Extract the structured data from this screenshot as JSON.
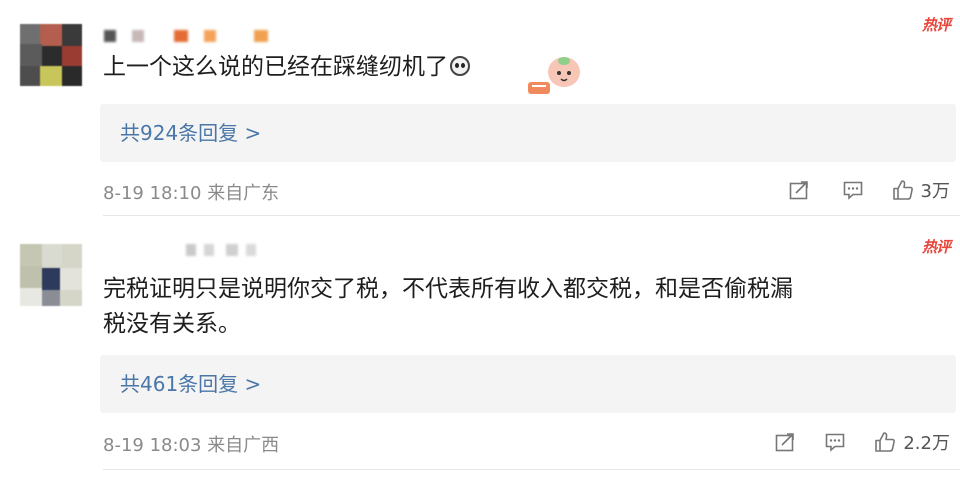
{
  "comments": [
    {
      "hot_badge": "热评",
      "text_lines": [
        "上一个这么说的已经在踩缝纫机了"
      ],
      "replies_label": "共924条回复 >",
      "timestamp": "8-19 18:10",
      "location": "来自广东",
      "likes": "3万",
      "icons": {
        "share": "share-icon",
        "comment": "comment-icon",
        "like": "thumbs-up-icon"
      }
    },
    {
      "hot_badge": "热评",
      "text_lines": [
        "完税证明只是说明你交了税，不代表所有收入都交税，和是否偷税漏",
        "税没有关系。"
      ],
      "replies_label": "共461条回复 >",
      "timestamp": "8-19 18:03",
      "location": "来自广西",
      "likes": "2.2万",
      "icons": {
        "share": "share-icon",
        "comment": "comment-icon",
        "like": "thumbs-up-icon"
      }
    }
  ],
  "colors": {
    "hot_badge": "#e8453c",
    "reply_link": "#4a76a8",
    "meta_text": "#8a8a8a",
    "reply_box_bg": "#f4f4f4"
  }
}
